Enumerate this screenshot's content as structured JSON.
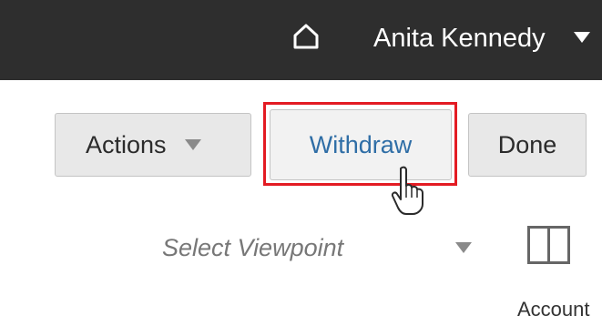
{
  "header": {
    "home_icon": "home-icon",
    "user_name": "Anita Kennedy",
    "user_menu_icon": "caret-down-icon",
    "background": "#2e2e2e"
  },
  "toolbar": {
    "actions_label": "Actions",
    "withdraw_label": "Withdraw",
    "done_label": "Done",
    "highlight_color": "#e31b23"
  },
  "viewpoint": {
    "placeholder": "Select Viewpoint",
    "layout_icon": "split-panel-icon",
    "account_label": "Account"
  }
}
